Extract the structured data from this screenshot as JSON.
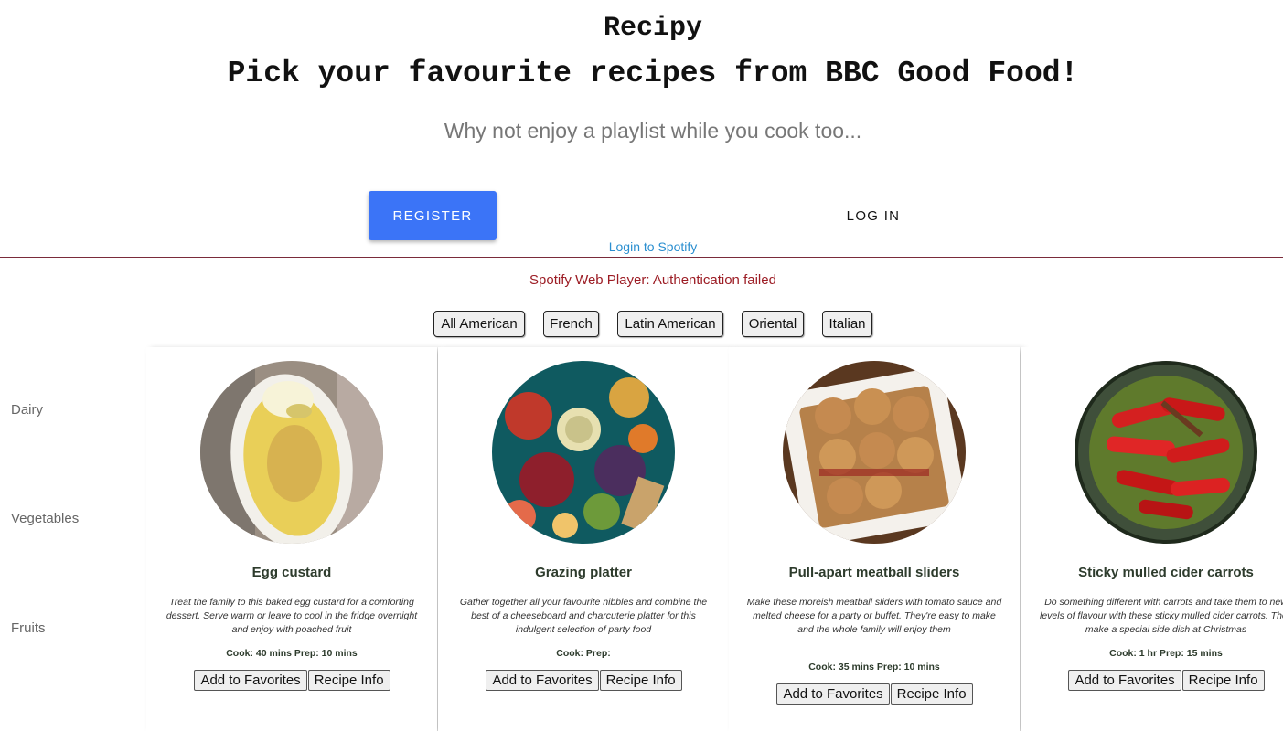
{
  "header": {
    "title": "Recipy",
    "subtitle": "Pick your favourite recipes from BBC Good Food!",
    "tagline": "Why not enjoy a playlist while you cook too..."
  },
  "auth": {
    "register_label": "REGISTER",
    "login_label": "LOG IN",
    "spotify_login_label": "Login to Spotify"
  },
  "player": {
    "status": "Spotify Web Player: Authentication failed"
  },
  "cuisines": [
    "All American",
    "French",
    "Latin American",
    "Oriental",
    "Italian"
  ],
  "categories": [
    "Dairy",
    "Vegetables",
    "Fruits"
  ],
  "recipe_actions": {
    "favorite_label": "Add to Favorites",
    "info_label": "Recipe Info"
  },
  "recipes": [
    {
      "name": "Egg custard",
      "description": "Treat the family to this baked egg custard for a comforting dessert. Serve warm or leave to cool in the fridge overnight and enjoy with poached fruit",
      "times": "Cook: 40 mins Prep: 10 mins"
    },
    {
      "name": "Grazing platter",
      "description": "Gather together all your favourite nibbles and combine the best of a cheeseboard and charcuterie platter for this indulgent selection of party food",
      "times": "Cook: Prep:"
    },
    {
      "name": "Pull-apart meatball sliders",
      "description": "Make these moreish meatball sliders with tomato sauce and melted cheese for a party or buffet. They're easy to make and the whole family will enjoy them",
      "times": "Cook: 35 mins Prep: 10 mins"
    },
    {
      "name": "Sticky mulled cider carrots",
      "description": "Do something different with carrots and take them to new levels of flavour with these sticky mulled cider carrots. They make a special side dish at Christmas",
      "times": "Cook: 1 hr Prep: 15 mins"
    }
  ]
}
